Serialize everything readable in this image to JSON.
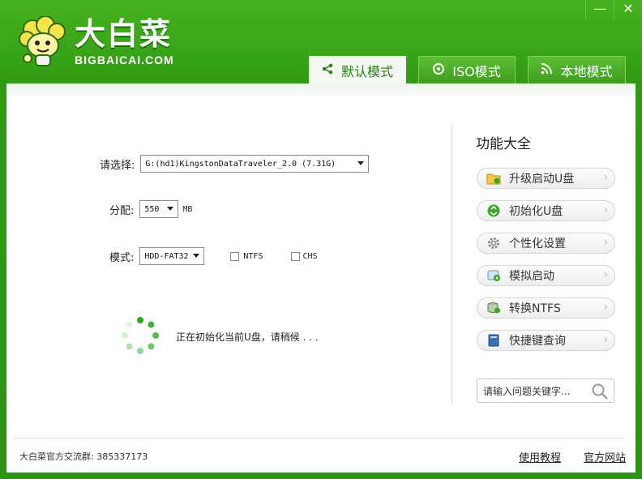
{
  "app": {
    "logo_cn": "大白菜",
    "logo_en": "BIGBAICAI.COM",
    "window_controls": {
      "minimize": "—",
      "close": "✕"
    }
  },
  "tabs": [
    {
      "label": "默认模式",
      "icon": "share-icon",
      "active": true
    },
    {
      "label": "ISO模式",
      "icon": "disc-icon",
      "active": false
    },
    {
      "label": "本地模式",
      "icon": "rss-icon",
      "active": false
    }
  ],
  "form": {
    "select_label": "请选择:",
    "device_value": "G:(hd1)KingstonDataTraveler_2.0 (7.31G)",
    "alloc_label": "分配:",
    "alloc_value": "550",
    "alloc_unit": "MB",
    "mode_label": "模式:",
    "mode_value": "HDD-FAT32",
    "ntfs_label": "NTFS",
    "chs_label": "CHS",
    "ntfs_checked": false,
    "chs_checked": false
  },
  "status": {
    "text": "正在初始化当前U盘，请稍候 . . ."
  },
  "side": {
    "title": "功能大全",
    "buttons": [
      {
        "label": "升级启动U盘",
        "icon": "upgrade-folder-icon"
      },
      {
        "label": "初始化U盘",
        "icon": "recycle-icon"
      },
      {
        "label": "个性化设置",
        "icon": "gear-icon"
      },
      {
        "label": "模拟启动",
        "icon": "simulate-start-icon"
      },
      {
        "label": "转换NTFS",
        "icon": "convert-disk-icon"
      },
      {
        "label": "快捷键查询",
        "icon": "book-icon"
      }
    ],
    "search_placeholder": "请输入问题关键字..."
  },
  "footer": {
    "qq_group": "大白菜官方交流群: 385337173",
    "tutorial_link": "使用教程",
    "website_link": "官方网站"
  },
  "colors": {
    "brand_green": "#3aa61b",
    "active_tab_text": "#2b7d16"
  }
}
